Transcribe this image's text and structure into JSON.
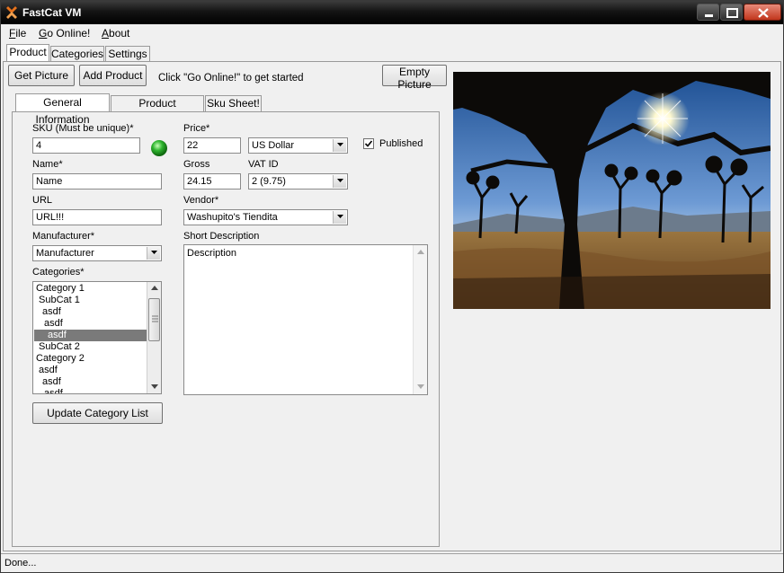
{
  "window": {
    "title": "FastCat VM"
  },
  "menu": {
    "file": "ile",
    "file_key": "F",
    "go_online": "o Online!",
    "go_online_key": "G",
    "about": "bout",
    "about_key": "A"
  },
  "main_tabs": [
    "Product",
    "Categories",
    "Settings"
  ],
  "toolbar": {
    "get_picture": "Get Picture",
    "add_product": "Add Product",
    "hint": "Click \"Go Online!\" to get started",
    "empty_picture": "Empty Picture"
  },
  "sub_tabs": [
    "General Information",
    "Product Description",
    "Sku Sheet!"
  ],
  "form": {
    "sku_label": "SKU (Must be unique)*",
    "sku_value": "4",
    "name_label": "Name*",
    "name_value": "Name",
    "url_label": "URL",
    "url_value": "URL!!!",
    "manufacturer_label": "Manufacturer*",
    "manufacturer_value": "Manufacturer",
    "categories_label": "Categories*",
    "categories": [
      "Category 1",
      "SubCat 1",
      "asdf",
      "asdf",
      "asdf",
      "SubCat 2",
      "Category 2",
      "asdf",
      "asdf",
      "asdf"
    ],
    "selected_category_index": 4,
    "update_button": "Update Category List",
    "price_label": "Price*",
    "price_value": "22",
    "currency_value": "US Dollar",
    "published_label": "Published",
    "published_checked": true,
    "gross_label": "Gross",
    "gross_value": "24.15",
    "vat_label": "VAT ID",
    "vat_value": "2 (9.75)",
    "vendor_label": "Vendor*",
    "vendor_value": "Washupito's Tiendita",
    "short_desc_label": "Short Description",
    "short_desc_value": "Description"
  },
  "status": {
    "text": "Done..."
  },
  "colors": {
    "online_indicator": "#2fb52f",
    "selection": "#7a7a7a"
  },
  "icons": [
    "app-icon",
    "minimize-icon",
    "maximize-icon",
    "close-icon",
    "status-led-icon",
    "checkbox-checked-icon",
    "dropdown-arrow-icon"
  ]
}
